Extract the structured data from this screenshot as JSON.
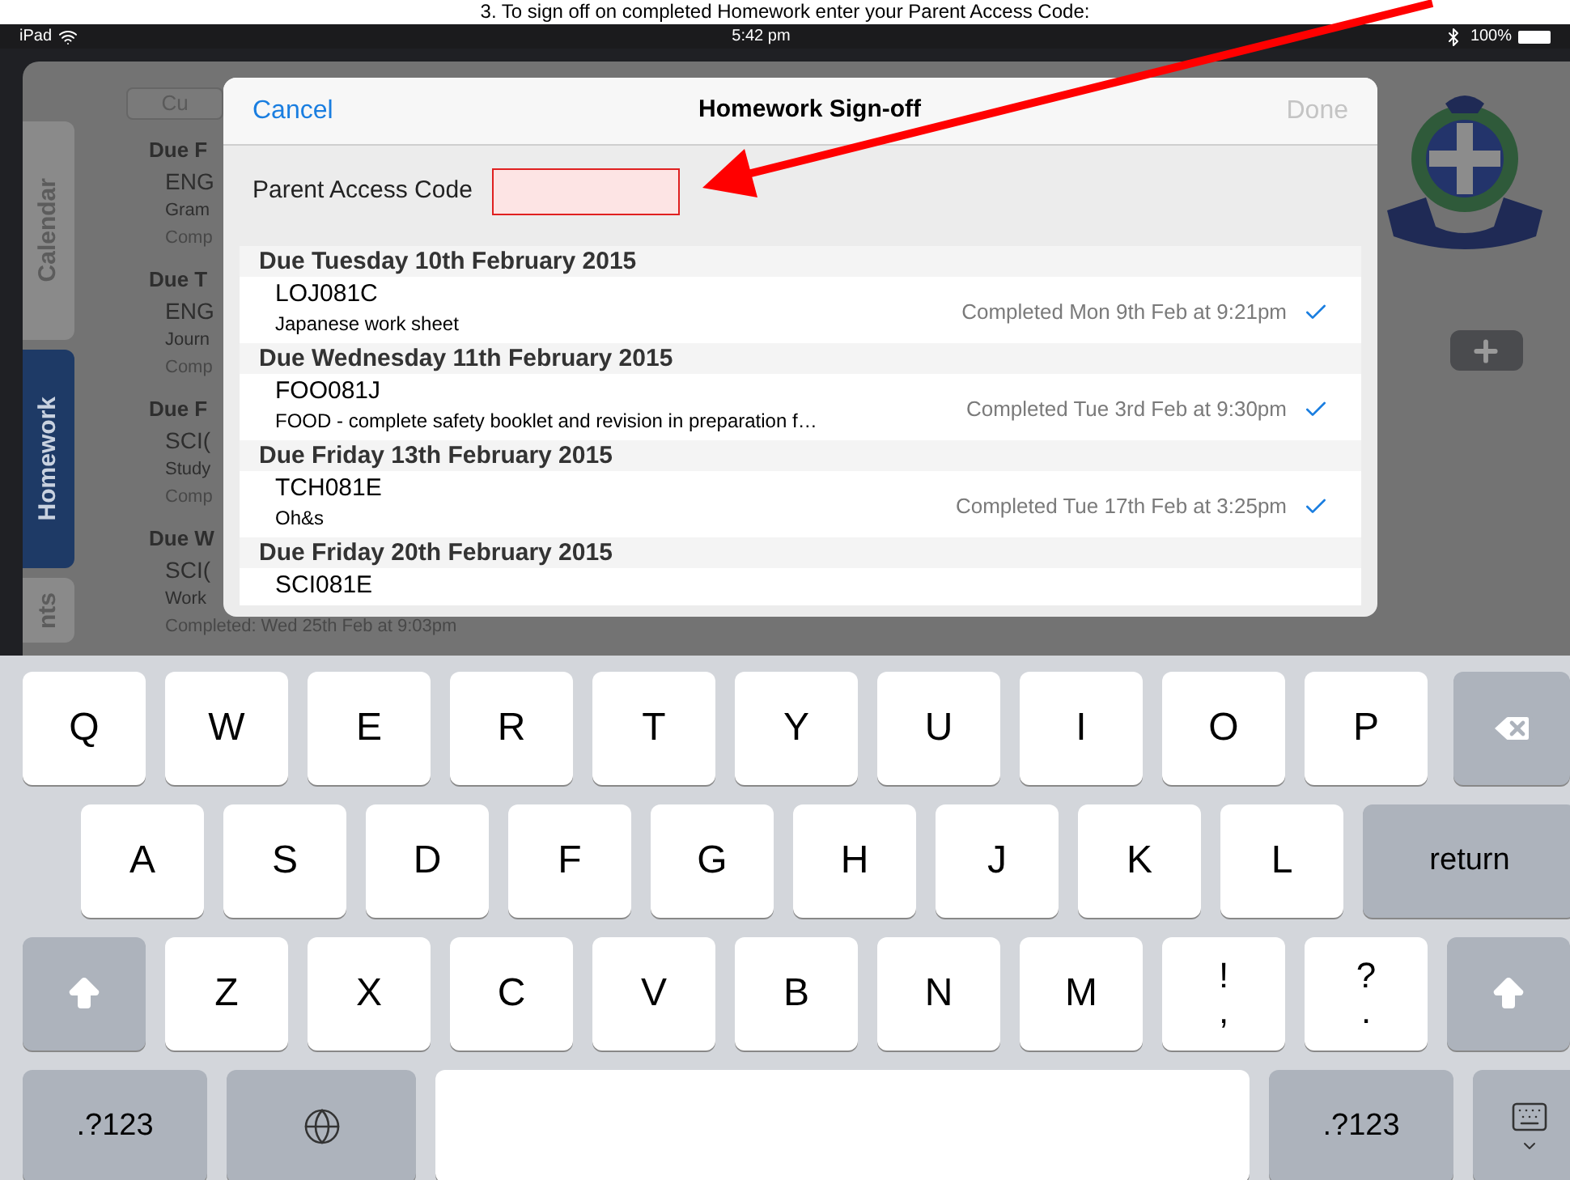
{
  "caption": "3.   To sign off on completed Homework enter your Parent Access Code:",
  "status_bar": {
    "device": "iPad",
    "time": "5:42 pm",
    "battery": "100%"
  },
  "background_app": {
    "side_tabs": [
      {
        "label": "Calendar",
        "selected": false
      },
      {
        "label": "Homework",
        "selected": true
      },
      {
        "label": "nts",
        "selected": false
      }
    ],
    "top_button": "Cu",
    "entries": [
      {
        "heading": "Due F",
        "code": "ENG",
        "description": "Gram",
        "status": "Comp"
      },
      {
        "heading": "Due T",
        "code": "ENG",
        "description": "Journ",
        "status": "Comp"
      },
      {
        "heading": "Due F",
        "code": "SCI(",
        "description": "Study",
        "status": "Comp"
      },
      {
        "heading": "Due W",
        "code": "SCI(",
        "description": "Work",
        "status": "Completed: Wed 25th Feb at 9:03pm"
      }
    ]
  },
  "dialog": {
    "title": "Homework Sign-off",
    "cancel": "Cancel",
    "done": {
      "label": "Done",
      "disabled": true
    },
    "field_label": "Parent Access Code",
    "sections": [
      {
        "heading": "Due Tuesday 10th February 2015",
        "items": [
          {
            "code": "LOJ081C",
            "description": "Japanese work sheet",
            "completed": "Completed Mon 9th Feb at 9:21pm",
            "checked": true
          }
        ]
      },
      {
        "heading": "Due Wednesday 11th February 2015",
        "items": [
          {
            "code": "FOO081J",
            "description": "FOOD - complete safety booklet and revision in preparation f…",
            "completed": "Completed Tue 3rd Feb at 9:30pm",
            "checked": true
          }
        ]
      },
      {
        "heading": "Due Friday 13th February 2015",
        "items": [
          {
            "code": "TCH081E",
            "description": "Oh&s",
            "completed": "Completed Tue 17th Feb at 3:25pm",
            "checked": true
          }
        ]
      },
      {
        "heading": "Due Friday 20th February 2015",
        "items": [
          {
            "code": "SCI081E"
          }
        ]
      }
    ]
  },
  "keyboard": {
    "rows": [
      {
        "keys": [
          {
            "kind": "letter",
            "label": "Q"
          },
          {
            "kind": "letter",
            "label": "W"
          },
          {
            "kind": "letter",
            "label": "E"
          },
          {
            "kind": "letter",
            "label": "R"
          },
          {
            "kind": "letter",
            "label": "T"
          },
          {
            "kind": "letter",
            "label": "Y"
          },
          {
            "kind": "letter",
            "label": "U"
          },
          {
            "kind": "letter",
            "label": "I"
          },
          {
            "kind": "letter",
            "label": "O"
          },
          {
            "kind": "letter",
            "label": "P"
          },
          {
            "kind": "delete"
          }
        ]
      },
      {
        "keys": [
          {
            "kind": "letter",
            "label": "A"
          },
          {
            "kind": "letter",
            "label": "S"
          },
          {
            "kind": "letter",
            "label": "D"
          },
          {
            "kind": "letter",
            "label": "F"
          },
          {
            "kind": "letter",
            "label": "G"
          },
          {
            "kind": "letter",
            "label": "H"
          },
          {
            "kind": "letter",
            "label": "J"
          },
          {
            "kind": "letter",
            "label": "K"
          },
          {
            "kind": "letter",
            "label": "L"
          },
          {
            "kind": "return",
            "label": "return"
          }
        ]
      },
      {
        "keys": [
          {
            "kind": "shift"
          },
          {
            "kind": "letter",
            "label": "Z"
          },
          {
            "kind": "letter",
            "label": "X"
          },
          {
            "kind": "letter",
            "label": "C"
          },
          {
            "kind": "letter",
            "label": "V"
          },
          {
            "kind": "letter",
            "label": "B"
          },
          {
            "kind": "letter",
            "label": "N"
          },
          {
            "kind": "letter",
            "label": "M"
          },
          {
            "kind": "punct",
            "top": "!",
            "bottom": ","
          },
          {
            "kind": "punct",
            "top": "?",
            "bottom": "."
          },
          {
            "kind": "shift"
          }
        ]
      },
      {
        "keys": [
          {
            "kind": "mode",
            "label": ".?123"
          },
          {
            "kind": "globe"
          },
          {
            "kind": "space"
          },
          {
            "kind": "mode",
            "label": ".?123"
          },
          {
            "kind": "hide"
          }
        ]
      }
    ]
  }
}
